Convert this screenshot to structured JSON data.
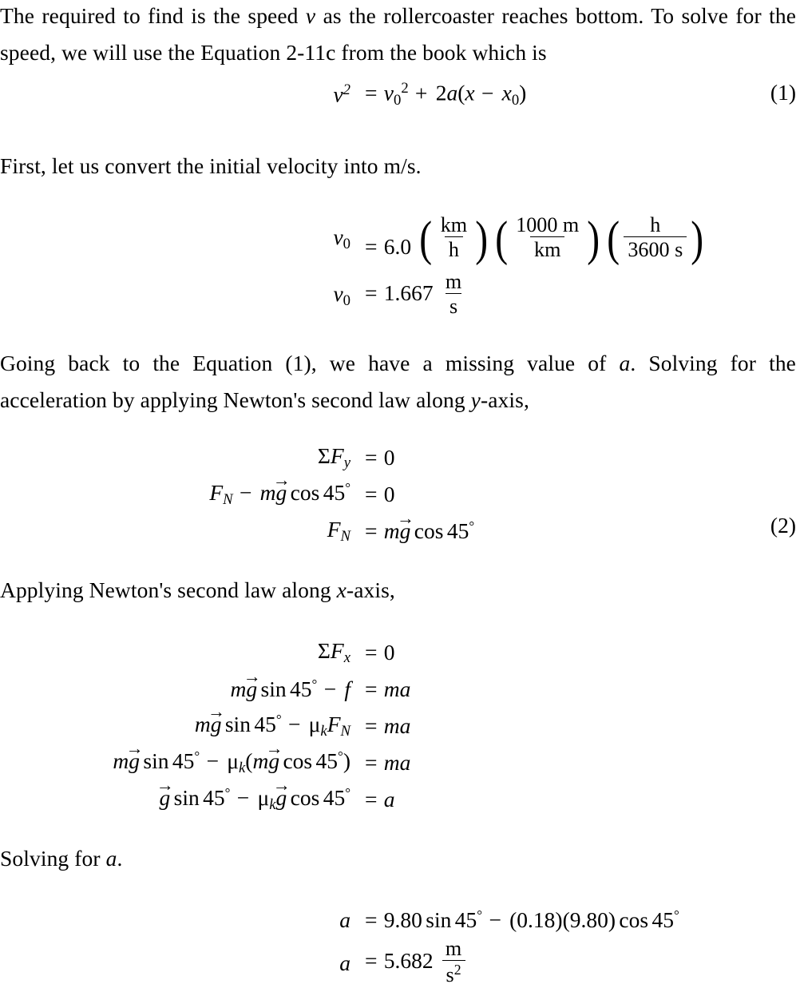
{
  "document": {
    "type": "physics-solution",
    "topic": "rollercoaster speed at bottom of incline",
    "paragraphs": {
      "intro": "The required to find is the speed v as the rollercoaster reaches bottom. To solve for the speed, we will use the Equation 2-11c from the book which is",
      "convert": "First, let us convert the initial velocity into m/s.",
      "missing_a": "Going back to the Equation (1), we have a missing value of a. Solving for the acceleration by applying Newton's second law along y-axis,",
      "xaxis": "Applying Newton's second law along x-axis,",
      "solving_for_a": "Solving for a."
    },
    "intro_parts": {
      "p1": "The required to find is the speed ",
      "v": "v",
      "p2": " as the rollercoaster reaches bottom. To solve for the speed, we will use the Equation ",
      "eqref": "2-11c",
      "p3": " from the book which is"
    },
    "missing_parts": {
      "p1": "Going back to the Equation (1), we have a missing value of ",
      "a": "a",
      "p2": ". Solving for the acceleration by applying Newton's second law along ",
      "y": "y",
      "p3": "-axis,"
    },
    "xaxis_parts": {
      "p1": "Applying Newton's second law along ",
      "x": "x",
      "p2": "-axis,"
    },
    "solving_parts": {
      "p1": "Solving for ",
      "a": "a",
      "p2": "."
    }
  },
  "equations": {
    "eq1": {
      "tag": "(1)",
      "lhs_var": "v",
      "lhs_exp": "2",
      "eq": "=",
      "rhs_v0": "v",
      "rhs_v0_sub": "0",
      "rhs_v0_sup": "2",
      "plus": "+",
      "two": "2",
      "a": "a",
      "open": "(",
      "x": "x",
      "minus": "−",
      "x0": "x",
      "x0_sub": "0",
      "close": ")"
    },
    "conversion": {
      "line1": {
        "lhs_v": "v",
        "lhs_sub": "0",
        "eq": "=",
        "value": "6.0",
        "f1_num": "km",
        "f1_den": "h",
        "f2_num": "1000 m",
        "f2_den": "km",
        "f3_num": "h",
        "f3_den": "3600 s"
      },
      "line2": {
        "lhs_v": "v",
        "lhs_sub": "0",
        "eq": "=",
        "value": "1.667",
        "unit_num": "m",
        "unit_den": "s"
      }
    },
    "yaxis": {
      "tag": "(2)",
      "line1": {
        "sigma": "Σ",
        "F": "F",
        "sub": "y",
        "eq": "=",
        "rhs": "0"
      },
      "line2": {
        "FN": "F",
        "FN_sub": "N",
        "minus": "−",
        "m": "m",
        "g": "g",
        "cos": "cos",
        "angle": "45",
        "deg": "°",
        "eq": "=",
        "rhs": "0"
      },
      "line3": {
        "FN": "F",
        "FN_sub": "N",
        "eq": "=",
        "m": "m",
        "g": "g",
        "cos": "cos",
        "angle": "45",
        "deg": "°"
      }
    },
    "xaxis": {
      "line1": {
        "sigma": "Σ",
        "F": "F",
        "sub": "x",
        "eq": "=",
        "rhs": "0"
      },
      "line2": {
        "m": "m",
        "g": "g",
        "sin": "sin",
        "angle": "45",
        "deg": "°",
        "minus": "−",
        "f": "f",
        "eq": "=",
        "rhs_m": "m",
        "rhs_a": "a"
      },
      "line3": {
        "m": "m",
        "g": "g",
        "sin": "sin",
        "angle": "45",
        "deg": "°",
        "minus": "−",
        "mu": "μ",
        "mu_sub": "k",
        "FN": "F",
        "FN_sub": "N",
        "eq": "=",
        "rhs_m": "m",
        "rhs_a": "a"
      },
      "line4": {
        "m": "m",
        "g": "g",
        "sin": "sin",
        "angle": "45",
        "deg": "°",
        "minus": "−",
        "mu": "μ",
        "mu_sub": "k",
        "open": "(",
        "m2": "m",
        "g2": "g",
        "cos": "cos",
        "angle2": "45",
        "deg2": "°",
        "close": ")",
        "eq": "=",
        "rhs_m": "m",
        "rhs_a": "a"
      },
      "line5": {
        "g": "g",
        "sin": "sin",
        "angle": "45",
        "deg": "°",
        "minus": "−",
        "mu": "μ",
        "mu_sub": "k",
        "g2": "g",
        "cos": "cos",
        "angle2": "45",
        "deg2": "°",
        "eq": "=",
        "rhs_a": "a"
      }
    },
    "acceleration": {
      "line1": {
        "a": "a",
        "eq": "=",
        "g": "9.80",
        "sin": "sin",
        "angle": "45",
        "deg": "°",
        "minus": "−",
        "open1": "(",
        "mu": "0.18",
        "close1": ")",
        "open2": "(",
        "g2": "9.80",
        "close2": ")",
        "cos": "cos",
        "angle2": "45",
        "deg2": "°"
      },
      "line2": {
        "a": "a",
        "eq": "=",
        "value": "5.682",
        "unit_num": "m",
        "unit_den": "s",
        "unit_den_exp": "2"
      }
    }
  },
  "values": {
    "v0_kmh": "6.0",
    "v0_ms": "1.667",
    "angle_deg": "45",
    "mu_k": "0.18",
    "g": "9.80",
    "a_result": "5.682",
    "a_units": "m/s^2"
  },
  "arrow_glyph": "→"
}
